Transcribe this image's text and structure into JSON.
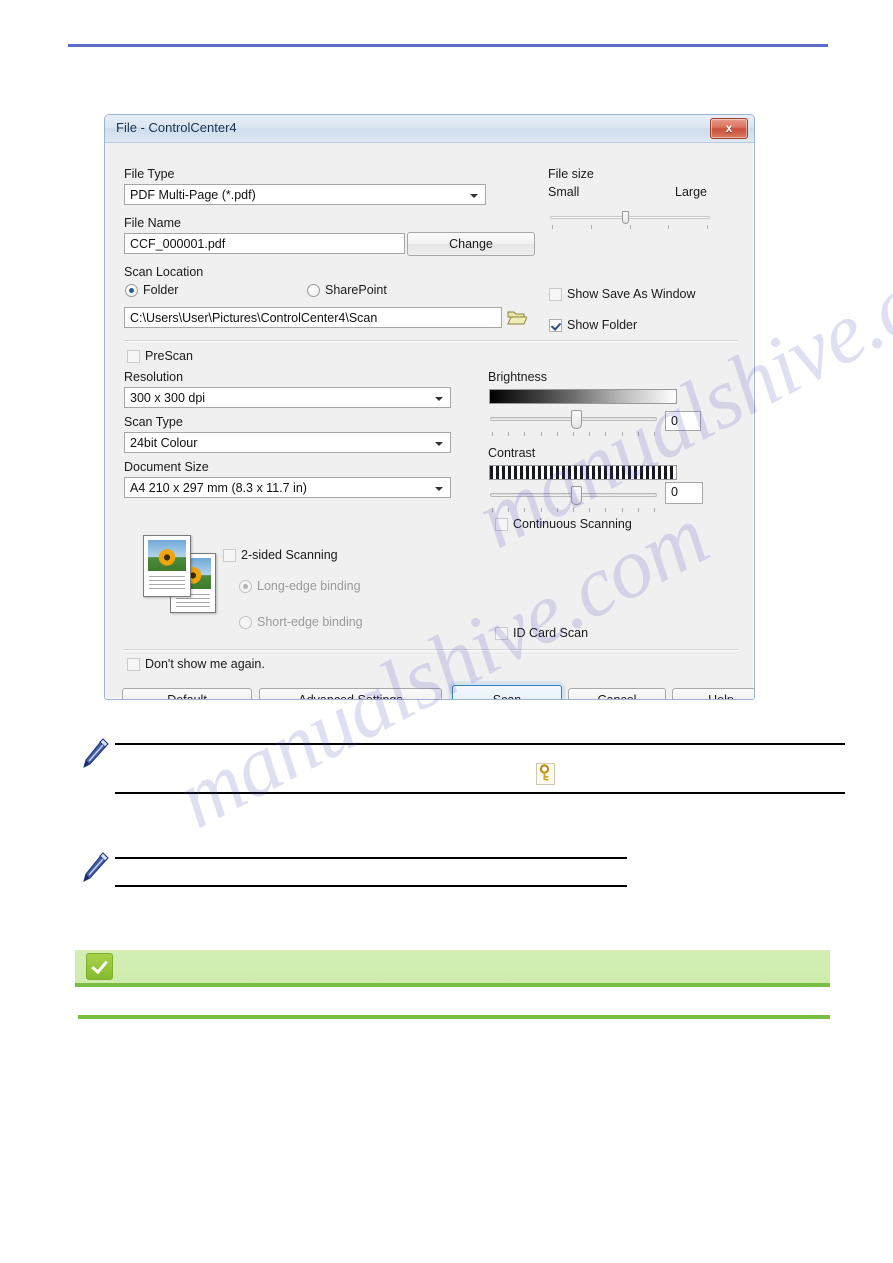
{
  "dialog": {
    "title": "File - ControlCenter4",
    "close_label": "x",
    "file_type": {
      "label": "File Type",
      "value": "PDF Multi-Page (*.pdf)"
    },
    "file_name": {
      "label": "File Name",
      "value": "CCF_000001.pdf",
      "change_button": "Change"
    },
    "file_size": {
      "label": "File size",
      "small_label": "Small",
      "large_label": "Large",
      "position_percent": 44
    },
    "scan_location": {
      "label": "Scan Location",
      "folder_radio": "Folder",
      "sharepoint_radio": "SharePoint",
      "selected": "Folder",
      "path": "C:\\Users\\User\\Pictures\\ControlCenter4\\Scan",
      "browse_icon": "folder-open-icon"
    },
    "show_save_as_window": {
      "label": "Show Save As Window",
      "checked": false
    },
    "show_folder": {
      "label": "Show Folder",
      "checked": true
    },
    "prescan": {
      "label": "PreScan",
      "checked": false
    },
    "resolution": {
      "label": "Resolution",
      "value": "300 x 300 dpi"
    },
    "scan_type": {
      "label": "Scan Type",
      "value": "24bit Colour"
    },
    "document_size": {
      "label": "Document Size",
      "value": "A4 210 x 297 mm (8.3 x 11.7 in)"
    },
    "brightness": {
      "label": "Brightness",
      "value": "0",
      "position_percent": 48
    },
    "contrast": {
      "label": "Contrast",
      "value": "0",
      "position_percent": 48
    },
    "continuous_scanning": {
      "label": "Continuous Scanning",
      "checked": false
    },
    "two_sided": {
      "label": "2-sided Scanning",
      "checked": false,
      "long_edge": "Long-edge binding",
      "short_edge": "Short-edge binding",
      "selected_binding": "Long-edge binding",
      "thumbnail_icon": "document-pages-icon"
    },
    "id_card_scan": {
      "label": "ID Card Scan",
      "checked": false
    },
    "dont_show_again": {
      "label": "Don't show me again.",
      "checked": false
    },
    "buttons": {
      "default": "Default",
      "advanced_settings": "Advanced Settings",
      "scan": "Scan",
      "cancel": "Cancel",
      "help": "Help"
    }
  },
  "notes": {
    "first_icon": "pencil-note-icon",
    "key_icon": "key-icon",
    "second_icon": "pencil-note-icon"
  },
  "tip_banner": {
    "icon": "check-badge-icon"
  },
  "watermark": {
    "line1": "manualshive.com",
    "line2": "manualshive.com"
  },
  "colors": {
    "accent_rule": "#5b6ec4",
    "green_rule": "#76bf43",
    "close_button": "#c8503c",
    "default_button_border": "#3c7fb1"
  }
}
